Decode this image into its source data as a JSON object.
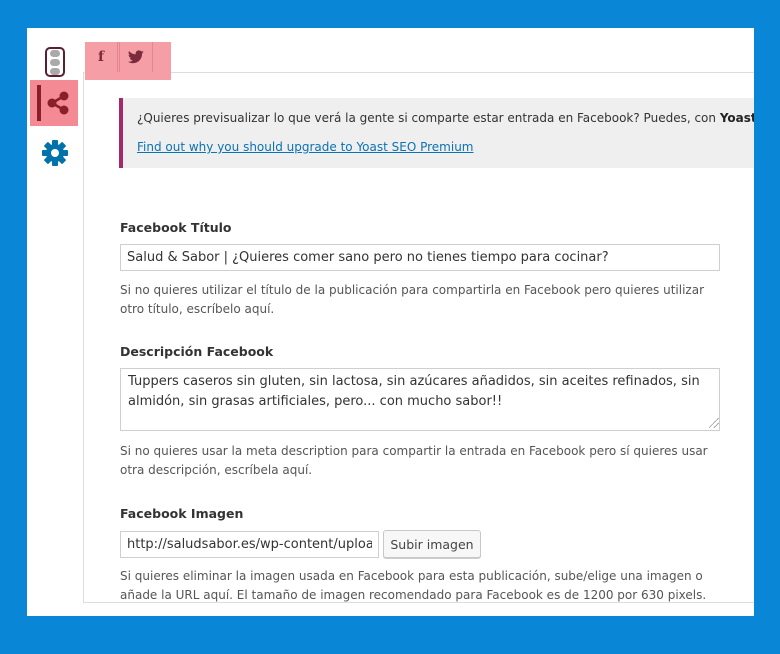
{
  "notice": {
    "text": "¿Quieres previsualizar lo que verá la gente si comparte estar entrada en Facebook? Puedes, con ",
    "brand": "Yoast SEO Premium",
    "link": "Find out why you should upgrade to Yoast SEO Premium",
    "accent_color": "#a4286a"
  },
  "tabs": [
    {
      "label": "f",
      "icon": "facebook-icon"
    },
    {
      "label": "",
      "icon": "twitter-icon"
    }
  ],
  "sidebar": {
    "items": [
      {
        "icon": "traffic-light-icon"
      },
      {
        "icon": "share-icon",
        "active": true
      },
      {
        "icon": "gear-icon"
      }
    ]
  },
  "form": {
    "title_label": "Facebook Título",
    "title_value": "Salud & Sabor | ¿Quieres comer sano pero no tienes tiempo para cocinar?",
    "title_help": "Si no quieres utilizar el título de la publicación para compartirla en Facebook pero quieres utilizar otro título, escríbelo aquí.",
    "description_label": "Descripción Facebook",
    "description_value": "Tuppers caseros sin gluten, sin lactosa, sin azúcares añadidos, sin aceites refinados, sin almidón, sin grasas artificiales, pero... con mucho sabor!!",
    "description_help": "Si no quieres usar la meta description para compartir la entrada en Facebook pero sí quieres usar otra descripción, escríbela aquí.",
    "image_label": "Facebook Imagen",
    "image_value": "http://saludsabor.es/wp-content/uploads/",
    "upload_button": "Subir imagen",
    "image_help": "Si quieres eliminar la imagen usada en Facebook para esta publicación, sube/elige una imagen o añade la URL aquí. El tamaño de imagen recomendado para Facebook es de 1200 por 630 pixels."
  },
  "colors": {
    "background": "#0a86d6",
    "highlight": "#f48a94",
    "link": "#0b72b3",
    "gear": "#0073aa"
  }
}
